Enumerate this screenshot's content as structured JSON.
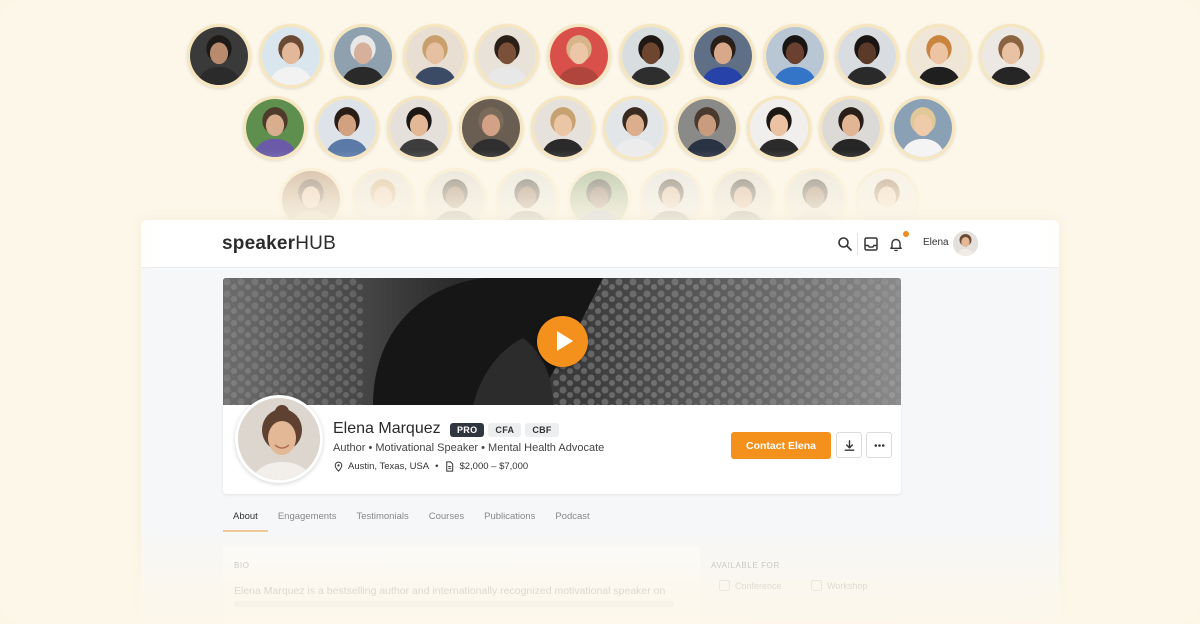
{
  "speakers_gallery": {
    "row1": [
      {
        "bg": "#3a3a3a",
        "skin": "#b98a6e",
        "hair": "#1e1a18",
        "shirt": "#2b2b2b"
      },
      {
        "bg": "#d9e6ee",
        "skin": "#e3b89a",
        "hair": "#6a4a32",
        "shirt": "#f2f2f2"
      },
      {
        "bg": "#8fa1ae",
        "skin": "#d6b09a",
        "hair": "#e8e8e8",
        "shirt": "#2a2a2a"
      },
      {
        "bg": "#e8ded2",
        "skin": "#e7c0a2",
        "hair": "#c9a06b",
        "shirt": "#3b4b66"
      },
      {
        "bg": "#e9e2d8",
        "skin": "#7a5038",
        "hair": "#2a2018",
        "shirt": "#e8e8e8"
      },
      {
        "bg": "#d9504a",
        "skin": "#ecc6a6",
        "hair": "#d8b48a",
        "shirt": "#b0453e"
      },
      {
        "bg": "#d8dde0",
        "skin": "#6e4630",
        "hair": "#1f1814",
        "shirt": "#2e2e2e"
      },
      {
        "bg": "#5e6f86",
        "skin": "#d7a88a",
        "hair": "#2a1e18",
        "shirt": "#2742a8"
      },
      {
        "bg": "#b9c6d4",
        "skin": "#6a4030",
        "hair": "#1a1512",
        "shirt": "#3575c7"
      },
      {
        "bg": "#d9dde2",
        "skin": "#5b3a2a",
        "hair": "#1a1512",
        "shirt": "#2a2a2a"
      },
      {
        "bg": "#f0e6d8",
        "skin": "#ecc3a3",
        "hair": "#c98440",
        "shirt": "#1f1f1f"
      },
      {
        "bg": "#ece9e4",
        "skin": "#e9c2a3",
        "hair": "#8a6440",
        "shirt": "#262626"
      }
    ],
    "row2": [
      {
        "bg": "#5f8f4f",
        "skin": "#d8ae8e",
        "hair": "#4e3b2a",
        "shirt": "#6a5aa8"
      },
      {
        "bg": "#dde3e8",
        "skin": "#d2a280",
        "hair": "#2a1d16",
        "shirt": "#5b7aa8"
      },
      {
        "bg": "#e5e0da",
        "skin": "#e2b896",
        "hair": "#1e1814",
        "shirt": "#3d3d3d"
      },
      {
        "bg": "#6a5e52",
        "skin": "#d3a286",
        "hair": "#7a6a5a",
        "shirt": "#2f2f2f"
      },
      {
        "bg": "#e6e1db",
        "skin": "#ebc6a6",
        "hair": "#c5a270",
        "shirt": "#2a2a2a"
      },
      {
        "bg": "#e2e6e8",
        "skin": "#dcae8e",
        "hair": "#3a2a20",
        "shirt": "#ececec"
      },
      {
        "bg": "#8a8a88",
        "skin": "#c99c7e",
        "hair": "#4a3a2e",
        "shirt": "#2a3344"
      },
      {
        "bg": "#f1efed",
        "skin": "#ebc3a4",
        "hair": "#1e1814",
        "shirt": "#2b2b2b"
      },
      {
        "bg": "#dcdad6",
        "skin": "#e2b694",
        "hair": "#2a1e18",
        "shirt": "#262626"
      },
      {
        "bg": "#8aa0b4",
        "skin": "#efcbaa",
        "hair": "#e0c898",
        "shirt": "#f4f4f4"
      }
    ],
    "row3": [
      {
        "bg": "#a8805e",
        "skin": "#e2b694",
        "hair": "#4a3020",
        "shirt": "#caa27c"
      },
      {
        "bg": "#e4dfd8",
        "skin": "#ecc6a6",
        "hair": "#c9a06b",
        "shirt": "#e8e8e8"
      },
      {
        "bg": "#d8d4cf",
        "skin": "#7a5038",
        "hair": "#2a2018",
        "shirt": "#3a3a3a"
      },
      {
        "bg": "#dcdcdc",
        "skin": "#6e4630",
        "hair": "#1e1814",
        "shirt": "#333"
      },
      {
        "bg": "#7a9a6a",
        "skin": "#5b3a2a",
        "hair": "#1a1512",
        "shirt": "#3f6db4"
      },
      {
        "bg": "#dadde2",
        "skin": "#d4a888",
        "hair": "#2a2018",
        "shirt": "#2e2e2e"
      },
      {
        "bg": "#d7d2cd",
        "skin": "#c8906e",
        "hair": "#1e1814",
        "shirt": "#2b2b2b"
      },
      {
        "bg": "#dedad4",
        "skin": "#7a5038",
        "hair": "#2a2018",
        "shirt": "#c9c2b6"
      },
      {
        "bg": "#f0ece6",
        "skin": "#ecc6a6",
        "hair": "#8a6440",
        "shirt": "#ececec"
      }
    ]
  },
  "header": {
    "logo_prefix": "speaker",
    "logo_suffix": "HUB",
    "user_name": "Elena"
  },
  "profile": {
    "name": "Elena Marquez",
    "badges": [
      "PRO",
      "CFA",
      "CBF"
    ],
    "title": "Author • Motivational Speaker • Mental Health Advocate",
    "location": "Austin, Texas, USA",
    "separator": "•",
    "fee": "$2,000 – $7,000",
    "contact_label": "Contact Elena"
  },
  "tabs": [
    "About",
    "Engagements",
    "Testimonials",
    "Courses",
    "Publications",
    "Podcast"
  ],
  "bio": {
    "heading": "BIO",
    "text": "Elena Marquez is a bestselling author and internationally recognized motivational speaker on"
  },
  "available_for": {
    "heading": "AVAILABLE FOR",
    "items": [
      "Conference",
      "Workshop"
    ]
  },
  "colors": {
    "accent": "#f3911c",
    "page_bg": "#fdf7e9",
    "pro_badge": "#2f3640"
  }
}
